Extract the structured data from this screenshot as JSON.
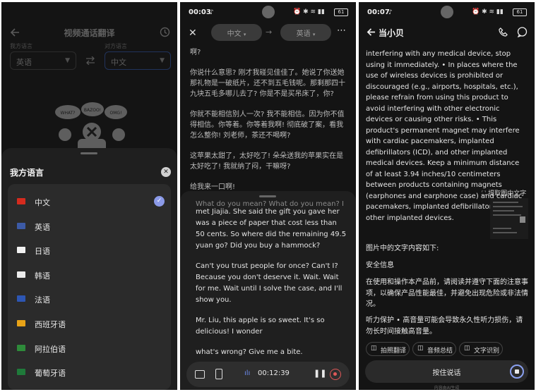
{
  "panel1": {
    "title": "视频通话翻译",
    "my_side_label": "我方语言",
    "other_side_label": "对方语言",
    "left_select": "英语",
    "right_select": "中文",
    "sticker_text_1": "WHAT?",
    "sticker_text_2": "BAZOO!",
    "sticker_text_3": "OMG!",
    "sheet_title": "我方语言",
    "languages": [
      {
        "label": "中文",
        "selected": true,
        "flag_color": "#d52b1e"
      },
      {
        "label": "英语",
        "selected": false,
        "flag_color": "#3c5aa6"
      },
      {
        "label": "日语",
        "selected": false,
        "flag_color": "#f2f2f2"
      },
      {
        "label": "韩语",
        "selected": false,
        "flag_color": "#ececec"
      },
      {
        "label": "法语",
        "selected": false,
        "flag_color": "#2d56b3"
      },
      {
        "label": "西班牙语",
        "selected": false,
        "flag_color": "#e8a317"
      },
      {
        "label": "阿拉伯语",
        "selected": false,
        "flag_color": "#2e8b3a"
      },
      {
        "label": "葡萄牙语",
        "selected": false,
        "flag_color": "#1f7a3a"
      }
    ]
  },
  "panel2": {
    "time": "00:03",
    "battery": "61",
    "source_lang": "中文",
    "target_lang": "英语",
    "cn_paragraphs": [
      "啊?",
      "你说什么意思? 刚才我碰见佳佳了。她说了你送她那礼物是一破纸片，还不到五毛钱呢。那剩那四十九块五毛多哪儿去了? 你是不是买吊床了，你?",
      "你就不能相信别人一次? 我不能相信。因为你不值得相信。你等着。你等着我啊! 彻底破了案，看我怎么整你! 刘老师，茶还不喝啊?",
      "这苹果太甜了，太好吃了! 朵朵送我的苹果实在是太好吃了! 我就纳了闷，干嘛呀?",
      "给我来一口啊!"
    ],
    "en_partial": "What do you mean? What do you mean? I just",
    "en_paragraphs": [
      "met Jiajia. She said the gift you gave her was a piece of paper that cost less than 50 cents. So where did the remaining 49.5 yuan go? Did you buy a hammock?",
      "Can't you trust people for once? Can't I? Because you don't deserve it. Wait. Wait for me. Wait until I solve the case, and I'll show you.",
      "Mr. Liu, this apple is so sweet. It's so delicious! I wonder",
      "what's wrong? Give me a bite."
    ],
    "timer": "00:12:39"
  },
  "panel3": {
    "time": "00:07",
    "battery": "61",
    "title": "当小贝",
    "english_text": "interfering with any medical device, stop using it immediately. • In places where the use of wireless devices is prohibited or discouraged (e.g., airports, hospitals, etc.), please refrain from using this product to avoid interfering with other electronic devices or causing other risks. • This product's permanent magnet may interfere with cardiac pacemakers, implanted defibrillators (ICD), and other implanted medical devices. Keep a minimum distance of at least 3.94 inches/10 centimeters between products containing magnets (earphones and earphone case) and cardiac pacemakers, implanted defibrillators, or other implanted devices.",
    "extract_label": "提取图中文字",
    "intro": "图片中的文字内容如下:",
    "heading": "安全信息",
    "para1": "在使用和操作本产品前，请阅读并遵守下面的注意事项，以确保产品性能最佳，并避免出现危险或非法情况。",
    "para2": "听力保护 • 高音量可能会导致永久性听力损伤，请勿长时间接触高音量。",
    "chips": [
      "拍照翻译",
      "音频总结",
      "文字识别"
    ],
    "hold_to_talk": "按住说话",
    "footer": "内容由AI生成"
  }
}
